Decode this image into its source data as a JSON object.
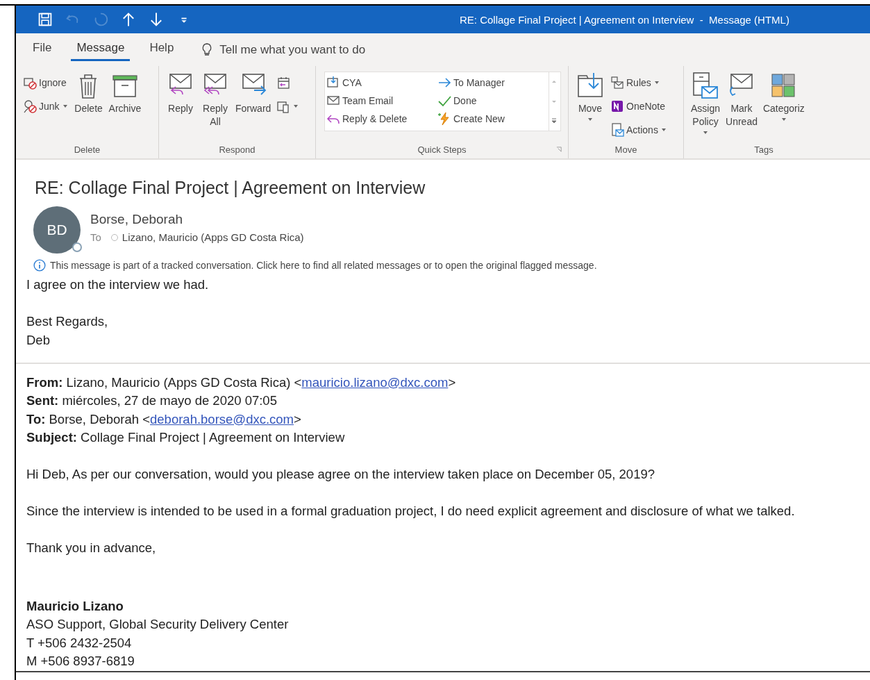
{
  "quick_access": [
    {
      "disabled": false
    },
    {
      "disabled": true
    },
    {
      "disabled": true
    },
    {
      "disabled": false
    },
    {
      "disabled": false
    },
    {
      "disabled": false
    }
  ],
  "window": {
    "title": "RE: Collage Final Project | Agreement on Interview  -  Message (HTML)"
  },
  "menu_tabs": [
    {
      "label": "File",
      "selected": false
    },
    {
      "label": "Message",
      "selected": true
    },
    {
      "label": "Help",
      "selected": false
    }
  ],
  "tell_me": {
    "placeholder": "Tell me what you want to do"
  },
  "ribbon": {
    "groups": [
      {
        "label": "Delete",
        "items": [
          {
            "label": "Ignore",
            "kind": "small",
            "dropdown": false
          },
          {
            "label": "Junk",
            "kind": "small",
            "dropdown": true
          },
          {
            "label": "Delete",
            "kind": "large",
            "dropdown": false
          },
          {
            "label": "Archive",
            "kind": "large",
            "dropdown": false
          }
        ]
      },
      {
        "label": "Respond",
        "items": [
          {
            "label": "Reply",
            "kind": "large",
            "dropdown": false
          },
          {
            "label": "Reply All",
            "kind": "large",
            "dropdown": false
          },
          {
            "label": "Forward",
            "kind": "large",
            "dropdown": false
          },
          {
            "kind": "small",
            "dropdown": false
          },
          {
            "kind": "small",
            "dropdown": true
          }
        ]
      },
      {
        "label": "Quick Steps",
        "kind": "gallery",
        "items": [
          {
            "label": "CYA"
          },
          {
            "label": "Team Email"
          },
          {
            "label": "Reply & Delete"
          },
          {
            "label": "To Manager"
          },
          {
            "label": "Done"
          },
          {
            "label": "Create New"
          }
        ]
      },
      {
        "label": "Move",
        "items": [
          {
            "label": "Move",
            "kind": "large",
            "dropdown": true
          },
          {
            "label": "Rules",
            "kind": "small",
            "dropdown": true
          },
          {
            "label": "OneNote",
            "kind": "small",
            "dropdown": false
          },
          {
            "label": "Actions",
            "kind": "small",
            "dropdown": true
          }
        ]
      },
      {
        "label": "Tags",
        "items": [
          {
            "label": "Assign Policy",
            "kind": "large",
            "dropdown": true
          },
          {
            "label": "Mark Unread",
            "kind": "large",
            "dropdown": false
          },
          {
            "label": "Categoriz",
            "kind": "large",
            "dropdown": true
          }
        ]
      }
    ]
  },
  "message": {
    "subject": "RE: Collage Final Project | Agreement on Interview",
    "sender": {
      "initials": "BD",
      "name": "Borse, Deborah",
      "to_label": "To",
      "to": "Lizano, Mauricio (Apps GD  Costa Rica)"
    },
    "info_bar": "This message is part of a tracked conversation. Click here to find all related messages or to open the original flagged message.",
    "reply": [
      [
        "I agree on the interview we had."
      ],
      [
        "Best Regards,",
        "Deb"
      ]
    ],
    "quoted_header": [
      {
        "label": "From:",
        "text": "Lizano, Mauricio (Apps GD Costa Rica) <",
        "link": "mauricio.lizano@dxc.com",
        "after": ">"
      },
      {
        "label": "Sent:",
        "text": "miércoles, 27 de mayo de 2020 07:05"
      },
      {
        "label": "To:",
        "text": "Borse, Deborah <",
        "link": "deborah.borse@dxc.com",
        "after": ">"
      },
      {
        "label": "Subject:",
        "text": "Collage Final Project | Agreement on Interview"
      }
    ],
    "quoted_body": [
      "Hi Deb, As per our conversation, would you please agree on the interview taken place on December 05, 2019?",
      "Since the interview is intended to be used in a formal graduation project, I do need explicit agreement and disclosure of what we talked.",
      "Thank you in advance,"
    ],
    "signature": {
      "name": "Mauricio Lizano",
      "lines": [
        "ASO Support, Global Security Delivery Center",
        "T +506 2432-2504",
        "M +506 8937-6819"
      ]
    }
  }
}
